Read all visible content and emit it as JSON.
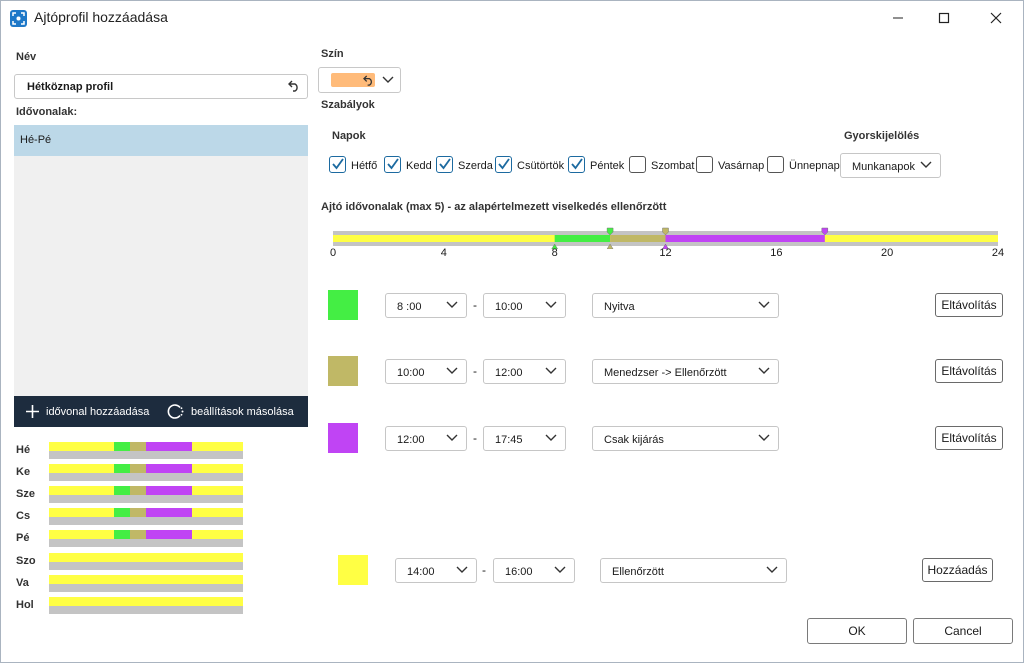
{
  "window": {
    "title": "Ajtóprofil hozzáadása",
    "icon": "app-icon"
  },
  "left": {
    "name_label": "Név",
    "name_value": "Hétköznap profil",
    "timelines_label": "Idővonalak:",
    "timelines": [
      {
        "label": "Hé-Pé",
        "selected": true
      }
    ],
    "add_timeline_label": "idővonal hozzáadása",
    "copy_settings_label": "beállítások másolása",
    "preview_days": [
      "Hé",
      "Ke",
      "Sze",
      "Cs",
      "Pé",
      "Szo",
      "Va",
      "Hol"
    ]
  },
  "color": {
    "label": "Szín",
    "value": "#ffbb7a"
  },
  "rules": {
    "label": "Szabályok",
    "days_label": "Napok",
    "quick_label": "Gyorskijelölés",
    "quick_value": "Munkanapok",
    "days": [
      {
        "label": "Hétfő",
        "checked": true
      },
      {
        "label": "Kedd",
        "checked": true
      },
      {
        "label": "Szerda",
        "checked": true
      },
      {
        "label": "Csütörtök",
        "checked": true
      },
      {
        "label": "Péntek",
        "checked": true
      },
      {
        "label": "Szombat",
        "checked": false
      },
      {
        "label": "Vasárnap",
        "checked": false
      },
      {
        "label": "Ünnepnap",
        "checked": false
      }
    ]
  },
  "timeline_section": {
    "label": "Ajtó idővonalak (max 5) - az alapértelmezett viselkedés ellenőrzött",
    "ticks": [
      "0",
      "4",
      "8",
      "12",
      "16",
      "20",
      "24"
    ],
    "segments": [
      {
        "start": 8,
        "end": 10,
        "color": "#44ee44"
      },
      {
        "start": 10,
        "end": 12,
        "color": "#c0b866"
      },
      {
        "start": 12,
        "end": 17.75,
        "color": "#c044f4"
      }
    ],
    "default_color": "#ffff44"
  },
  "intervals": [
    {
      "color": "#44ee44",
      "from": "8 :00",
      "to": "10:00",
      "mode": "Nyitva",
      "button": "Eltávolítás"
    },
    {
      "color": "#c0b866",
      "from": "10:00",
      "to": "12:00",
      "mode": "Menedzser -> Ellenőrzött",
      "button": "Eltávolítás"
    },
    {
      "color": "#c044f4",
      "from": "12:00",
      "to": "17:45",
      "mode": "Csak kijárás",
      "button": "Eltávolítás"
    }
  ],
  "new_interval": {
    "color": "#ffff44",
    "from": "14:00",
    "to": "16:00",
    "mode": "Ellenőrzött",
    "button": "Hozzáadás"
  },
  "separator": "-",
  "footer": {
    "ok": "OK",
    "cancel": "Cancel"
  },
  "colors": {
    "open": "#44ee44",
    "manager": "#c0b866",
    "exit_only": "#c044f4",
    "controlled": "#ffff44",
    "off": "#c4c4c4"
  }
}
